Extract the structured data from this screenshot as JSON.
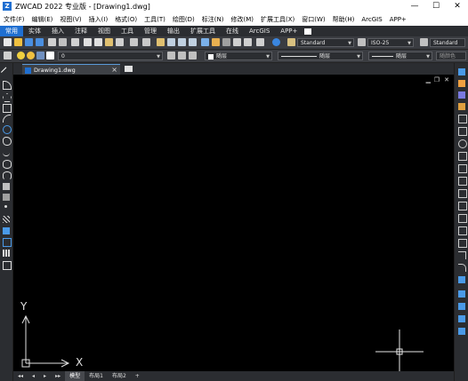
{
  "window": {
    "title": "ZWCAD 2022 专业版 - [Drawing1.dwg]",
    "app_icon_label": "Z",
    "minimize": "—",
    "maximize": "☐",
    "close": "✕"
  },
  "menus": [
    "文件(F)",
    "编辑(E)",
    "视图(V)",
    "插入(I)",
    "格式(O)",
    "工具(T)",
    "绘图(D)",
    "标注(N)",
    "修改(M)",
    "扩展工具(X)",
    "窗口(W)",
    "帮助(H)",
    "ArcGIS",
    "APP+"
  ],
  "ribbon_tabs": [
    "常用",
    "实体",
    "插入",
    "注释",
    "视图",
    "工具",
    "管理",
    "输出",
    "扩展工具",
    "在线",
    "ArcGIS",
    "APP+"
  ],
  "ribbon_active_tab": "常用",
  "toolbar": {
    "text_style": "Standard",
    "dim_style": "ISO-25",
    "table_style": "Standard",
    "layer": "0",
    "color": "随层",
    "linetype": "随层",
    "lineweight": "随层",
    "plotstyle": "随颜色"
  },
  "document": {
    "tab_name": "Drawing1.dwg",
    "tab_close": "×",
    "tab_new": "+"
  },
  "viewport": {
    "minimize": "▁",
    "restore": "❐",
    "close": "✕",
    "ucs_x": "X",
    "ucs_y": "Y"
  },
  "layout_tabs": {
    "nav": [
      "◂◂",
      "◂",
      "▸",
      "▸▸"
    ],
    "tabs": [
      "模型",
      "布局1",
      "布局2"
    ],
    "active": "模型",
    "add": "+"
  },
  "colors": {
    "accent": "#1f6fd1",
    "canvas": "#000000",
    "chrome": "#2b2d31"
  }
}
